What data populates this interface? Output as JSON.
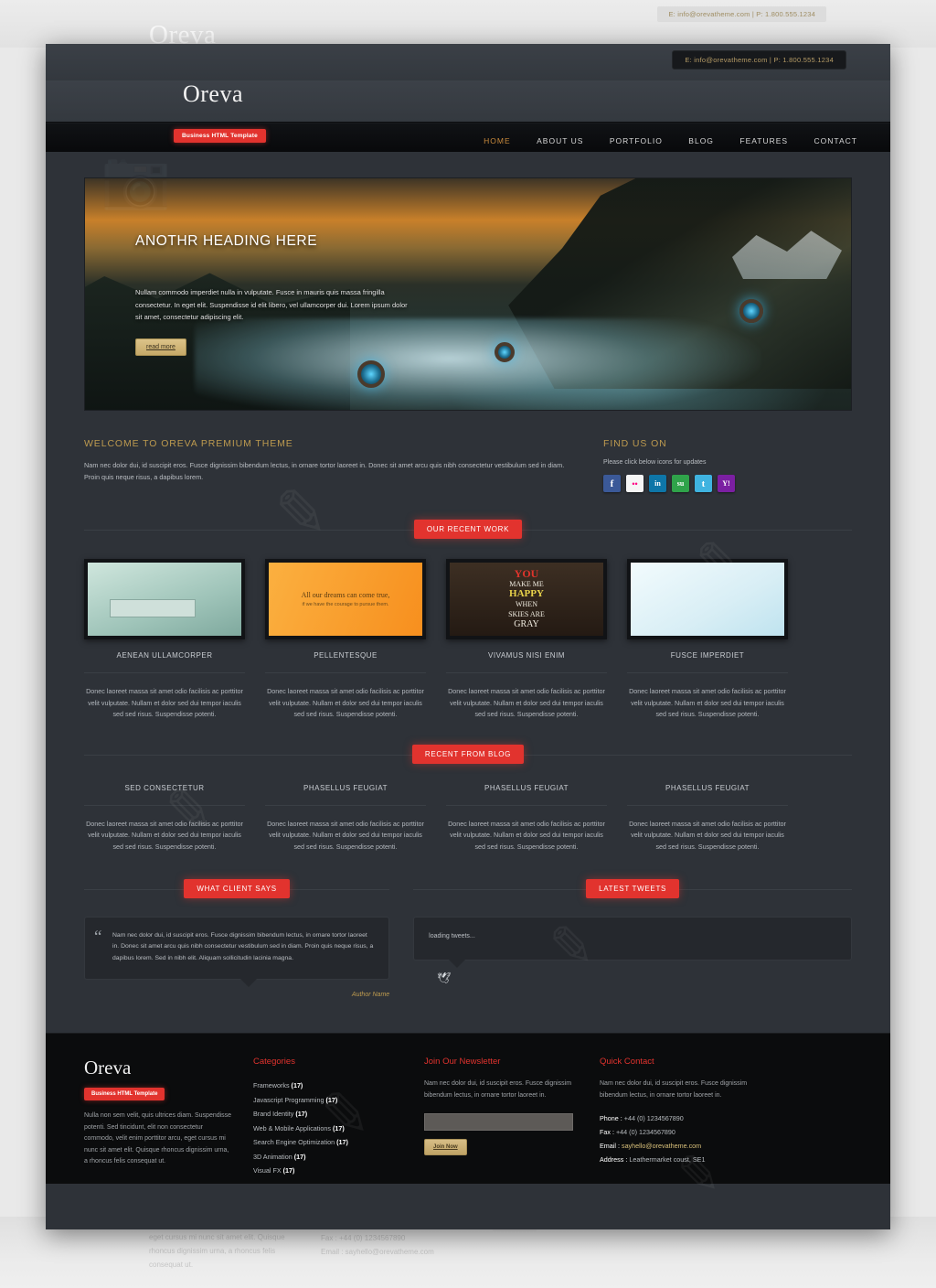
{
  "topbar": {
    "contact": "E: info@orevatheme.com | P: 1.800.555.1234"
  },
  "brand": {
    "name": "Oreva",
    "tagline": "Business HTML Template"
  },
  "nav": {
    "items": [
      {
        "label": "HOME",
        "active": true
      },
      {
        "label": "ABOUT US",
        "active": false
      },
      {
        "label": "PORTFOLIO",
        "active": false
      },
      {
        "label": "BLOG",
        "active": false
      },
      {
        "label": "FEATURES",
        "active": false
      },
      {
        "label": "CONTACT",
        "active": false
      }
    ]
  },
  "slider": {
    "title": "ANOTHR HEADING HERE",
    "body": "Nullam commodo imperdiet nulla in vulputate. Fusce in mauris quis massa fringilla consectetur. In eget elit. Suspendisse id elit libero, vel ullamcorper dui. Lorem ipsum dolor sit amet, consectetur adipiscing elit.",
    "button": "read more"
  },
  "welcome": {
    "heading": "WELCOME TO OREVA PREMIUM THEME",
    "body": "Nam nec dolor dui, id suscipit eros. Fusce dignissim bibendum lectus, in ornare tortor laoreet in. Donec sit amet arcu quis nibh consectetur vestibulum sed in diam. Proin quis neque risus, a dapibus lorem."
  },
  "find_us": {
    "heading": "FIND US ON",
    "subtext": "Please click below icons for updates",
    "icons": [
      {
        "name": "facebook-icon",
        "glyph": "f",
        "color": "#3b5998"
      },
      {
        "name": "flickr-icon",
        "glyph": "••",
        "color": "#f5f5f5"
      },
      {
        "name": "linkedin-icon",
        "glyph": "in",
        "color": "#0e76a8"
      },
      {
        "name": "stumbleupon-icon",
        "glyph": "su",
        "color": "#2fa34a"
      },
      {
        "name": "twitter-icon",
        "glyph": "t",
        "color": "#3fb3e0"
      },
      {
        "name": "yahoo-icon",
        "glyph": "Y!",
        "color": "#7b1fa2"
      }
    ]
  },
  "portfolio": {
    "tab": "OUR RECENT WORK",
    "items": [
      {
        "title": "AENEAN ULLAMCORPER",
        "body": "Donec laoreet massa sit amet odio facilisis ac porttitor velit vulputate. Nullam et dolor sed dui tempor iaculis sed sed risus. Suspendisse potenti."
      },
      {
        "title": "PELLENTESQUE",
        "body": "Donec laoreet massa sit amet odio facilisis ac porttitor velit vulputate. Nullam et dolor sed dui tempor iaculis sed sed risus. Suspendisse potenti."
      },
      {
        "title": "VIVAMUS NISI ENIM",
        "body": "Donec laoreet massa sit amet odio facilisis ac porttitor velit vulputate. Nullam et dolor sed dui tempor iaculis sed sed risus. Suspendisse potenti."
      },
      {
        "title": "FUSCE IMPERDIET",
        "body": "Donec laoreet massa sit amet odio facilisis ac porttitor velit vulputate. Nullam et dolor sed dui tempor iaculis sed sed risus. Suspendisse potenti."
      }
    ],
    "thumb_text": {
      "t2_line1": "All our dreams can come true,",
      "t2_line2": "if we have the courage to pursue them.",
      "t3_you": "YOU",
      "t3_make": "MAKE ME",
      "t3_happy": "HAPPY",
      "t3_when": "WHEN",
      "t3_skies": "SKIES ARE",
      "t3_gray": "GRAY"
    }
  },
  "blog": {
    "tab": "RECENT FROM BLOG",
    "items": [
      {
        "title": "SED CONSECTETUR",
        "body": "Donec laoreet massa sit amet odio facilisis ac porttitor velit vulputate. Nullam et dolor sed dui tempor iaculis sed sed risus. Suspendisse potenti."
      },
      {
        "title": "PHASELLUS FEUGIAT",
        "body": "Donec laoreet massa sit amet odio facilisis ac porttitor velit vulputate. Nullam et dolor sed dui tempor iaculis sed sed risus. Suspendisse potenti."
      },
      {
        "title": "PHASELLUS FEUGIAT",
        "body": "Donec laoreet massa sit amet odio facilisis ac porttitor velit vulputate. Nullam et dolor sed dui tempor iaculis sed sed risus. Suspendisse potenti."
      },
      {
        "title": "PHASELLUS FEUGIAT",
        "body": "Donec laoreet massa sit amet odio facilisis ac porttitor velit vulputate. Nullam et dolor sed dui tempor iaculis sed sed risus. Suspendisse potenti."
      }
    ]
  },
  "testimonial": {
    "tab": "WHAT CLIENT SAYS",
    "quote_mark": "“",
    "text": "Nam nec dolor dui, id suscipit eros. Fusce dignissim bibendum lectus, in ornare tortor laoreet in. Donec sit amet arcu quis nibh consectetur vestibulum sed in diam. Proin quis neque risus, a dapibus lorem. Sed in nibh elit. Aliquam sollicitudin lacinia magna.",
    "author": "Author Name"
  },
  "tweets": {
    "tab": "LATEST TWEETS",
    "status": "loading tweets...",
    "bird": "🕊"
  },
  "footer": {
    "brand": "Oreva",
    "tagline": "Business HTML Template",
    "about": "Nulla non sem velit, quis ultrices diam. Suspendisse potenti. Sed tincidunt, elit non consectetur commodo, velit enim porttitor arcu, eget cursus mi nunc sit amet elit. Quisque rhoncus dignissim urna, a rhoncus felis consequat ut.",
    "categories_head": "Categories",
    "categories": [
      {
        "label": "Frameworks",
        "count": "(17)"
      },
      {
        "label": "Javascript Programming",
        "count": "(17)"
      },
      {
        "label": "Brand Identity",
        "count": "(17)"
      },
      {
        "label": "Web & Mobile Applications",
        "count": "(17)"
      },
      {
        "label": "Search Engine Optimization",
        "count": "(17)"
      },
      {
        "label": "3D Animation",
        "count": "(17)"
      },
      {
        "label": "Visual FX",
        "count": "(17)"
      }
    ],
    "newsletter_head": "Join Our Newsletter",
    "newsletter_text": "Nam nec dolor dui, id suscipit eros. Fusce dignissim bibendum lectus, in ornare tortor laoreet in.",
    "newsletter_value": "",
    "newsletter_placeholder": "",
    "join_button": "Join Now",
    "contact_head": "Quick Contact",
    "contact_text": "Nam nec dolor dui, id suscipit eros. Fusce dignissim bibendum lectus, in ornare tortor laoreet in.",
    "contact_rows": [
      {
        "label": "Phone :",
        "value": "+44 (0) 1234567890",
        "mail": false
      },
      {
        "label": "Fax :",
        "value": "+44 (0) 1234567890",
        "mail": false
      },
      {
        "label": "Email :",
        "value": "sayhello@orevatheme.com",
        "mail": true
      },
      {
        "label": "Address :",
        "value": "Leathermarket coust, SE1",
        "mail": false
      }
    ]
  },
  "colors": {
    "accent_red": "#e2332e",
    "gold": "#bd9a4f",
    "bg_dark": "#2e3238",
    "footer_bg": "#0b0c0d"
  }
}
